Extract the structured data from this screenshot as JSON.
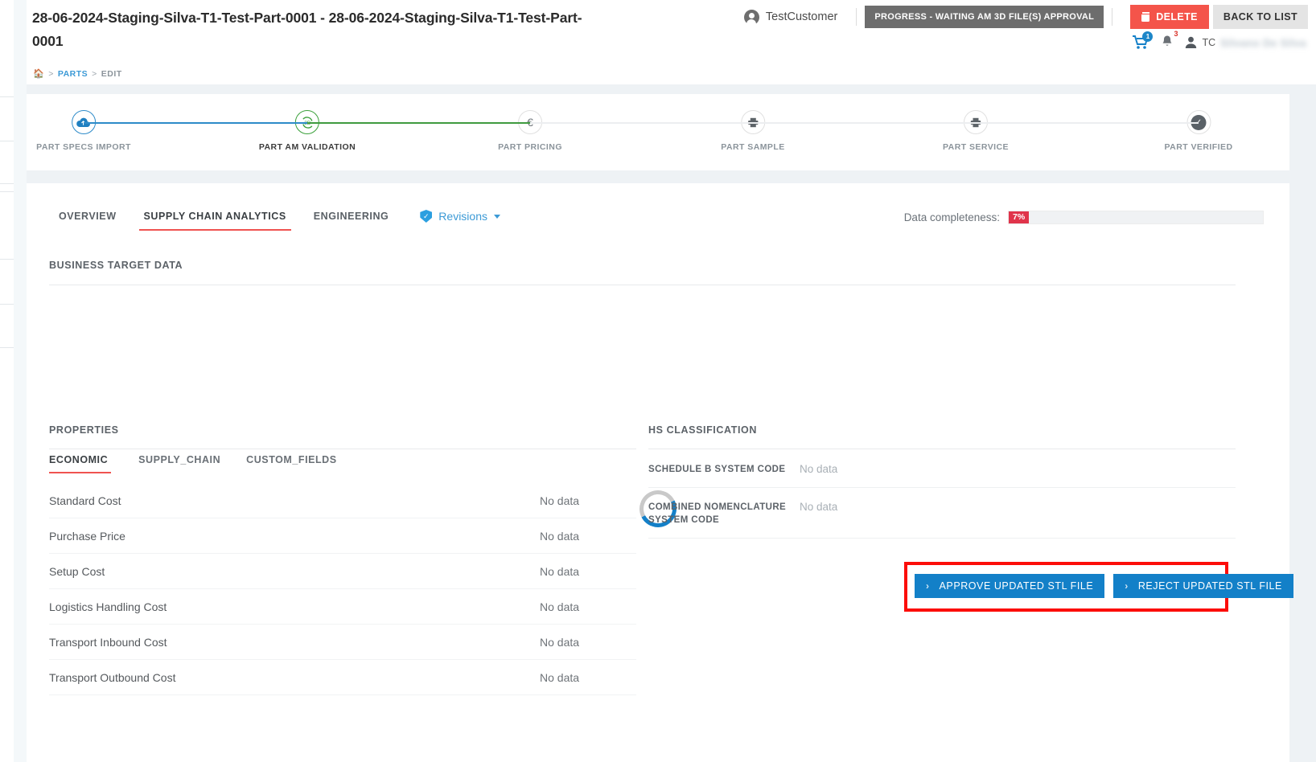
{
  "header": {
    "title": "28-06-2024-Staging-Silva-T1-Test-Part-0001 - 28-06-2024-Staging-Silva-T1-Test-Part-0001",
    "customer_name": "TestCustomer",
    "progress_badge": "PROGRESS - WAITING AM 3D FILE(S) APPROVAL",
    "delete_label": "DELETE",
    "back_label": "BACK TO LIST",
    "cart_badge": "1",
    "bell_badge": "3",
    "user_initials": "TC",
    "user_name_blurred": "Silvano De Silva"
  },
  "breadcrumb": {
    "home_icon": "home-icon",
    "sep": ">",
    "parts": "PARTS",
    "current": "EDIT"
  },
  "stepper": {
    "steps": [
      {
        "label": "PART SPECS IMPORT",
        "icon": "cloud-upload-icon",
        "state": "done"
      },
      {
        "label": "PART AM VALIDATION",
        "icon": "3d-rotate-icon",
        "state": "active"
      },
      {
        "label": "PART PRICING",
        "icon": "euro-icon",
        "state": "pending"
      },
      {
        "label": "PART SAMPLE",
        "icon": "printer-icon",
        "state": "pending"
      },
      {
        "label": "PART SERVICE",
        "icon": "printer-icon",
        "state": "pending"
      },
      {
        "label": "PART VERIFIED",
        "icon": "check-shield-icon",
        "state": "pending"
      }
    ]
  },
  "tabs": [
    {
      "label": "OVERVIEW",
      "active": false
    },
    {
      "label": "SUPPLY CHAIN ANALYTICS",
      "active": true
    },
    {
      "label": "ENGINEERING",
      "active": false
    }
  ],
  "revisions": {
    "label": "Revisions",
    "icon": "shield-check-icon"
  },
  "completeness": {
    "label": "Data completeness:",
    "value": "7%",
    "percent": 7
  },
  "business_target": {
    "title": "BUSINESS TARGET DATA",
    "loading": true
  },
  "actions": {
    "approve_label": "APPROVE UPDATED STL FILE",
    "reject_label": "REJECT UPDATED STL FILE",
    "chevron": "›",
    "highlight_color": "#fc0d09"
  },
  "properties": {
    "title": "PROPERTIES",
    "tabs": [
      {
        "label": "ECONOMIC",
        "active": true
      },
      {
        "label": "SUPPLY_CHAIN",
        "active": false
      },
      {
        "label": "CUSTOM_FIELDS",
        "active": false
      }
    ],
    "rows": [
      {
        "label": "Standard Cost",
        "value": "No data"
      },
      {
        "label": "Purchase Price",
        "value": "No data"
      },
      {
        "label": "Setup Cost",
        "value": "No data"
      },
      {
        "label": "Logistics Handling Cost",
        "value": "No data"
      },
      {
        "label": "Transport Inbound Cost",
        "value": "No data"
      },
      {
        "label": "Transport Outbound Cost",
        "value": "No data"
      }
    ]
  },
  "hs_classification": {
    "title": "HS CLASSIFICATION",
    "rows": [
      {
        "label": "SCHEDULE B SYSTEM CODE",
        "value": "No data"
      },
      {
        "label": "COMBINED NOMENCLATURE SYSTEM CODE",
        "value": "No data"
      }
    ]
  },
  "colors": {
    "accent_red": "#ef5350",
    "brand_blue": "#1380c8",
    "step_done": "#2e8bc9",
    "step_active": "#3aa03a",
    "delete_red": "#f4544a",
    "completeness_red": "#e0344b"
  }
}
